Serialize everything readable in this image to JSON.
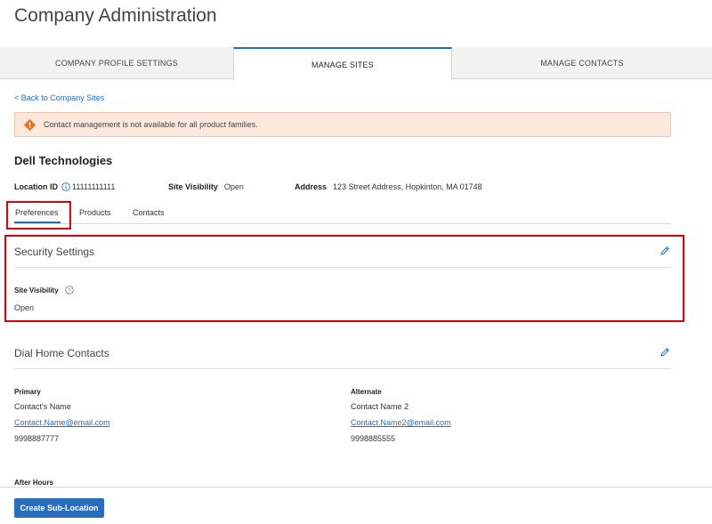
{
  "page": {
    "title": "Company Administration"
  },
  "main_tabs": [
    {
      "label": "COMPANY PROFILE SETTINGS"
    },
    {
      "label": "MANAGE SITES"
    },
    {
      "label": "MANAGE CONTACTS"
    }
  ],
  "back_link": "< Back to Company Sites",
  "alert": {
    "text": "Contact management is not available for all product families.",
    "color": "#fce8dc",
    "icon": "warning-icon"
  },
  "company": {
    "name": "Dell Technologies",
    "location_id_label": "Location ID",
    "location_id": "11111111111",
    "site_visibility_label": "Site Visibility",
    "site_visibility": "Open",
    "address_label": "Address",
    "address": "123 Street Address, Hopkinton, MA 01748"
  },
  "sub_tabs": [
    {
      "label": "Preferences"
    },
    {
      "label": "Products"
    },
    {
      "label": "Contacts"
    }
  ],
  "security": {
    "title": "Security Settings",
    "site_visibility_label": "Site Visibility",
    "site_visibility_value": "Open"
  },
  "dial_home": {
    "title": "Dial Home Contacts",
    "primary": {
      "label": "Primary",
      "name": "Contact's Name",
      "email": "Contact.Name@email.com",
      "phone": "9998887777"
    },
    "alternate": {
      "label": "Alternate",
      "name": "Contact Name 2",
      "email": "Contact.Name2@email.com",
      "phone": "9998885555"
    },
    "after_hours_label": "After Hours"
  },
  "footer": {
    "create_button": "Create Sub-Location"
  },
  "colors": {
    "accent": "#1f6fbf",
    "highlight": "#d9000d",
    "button": "#2a6ebb"
  }
}
